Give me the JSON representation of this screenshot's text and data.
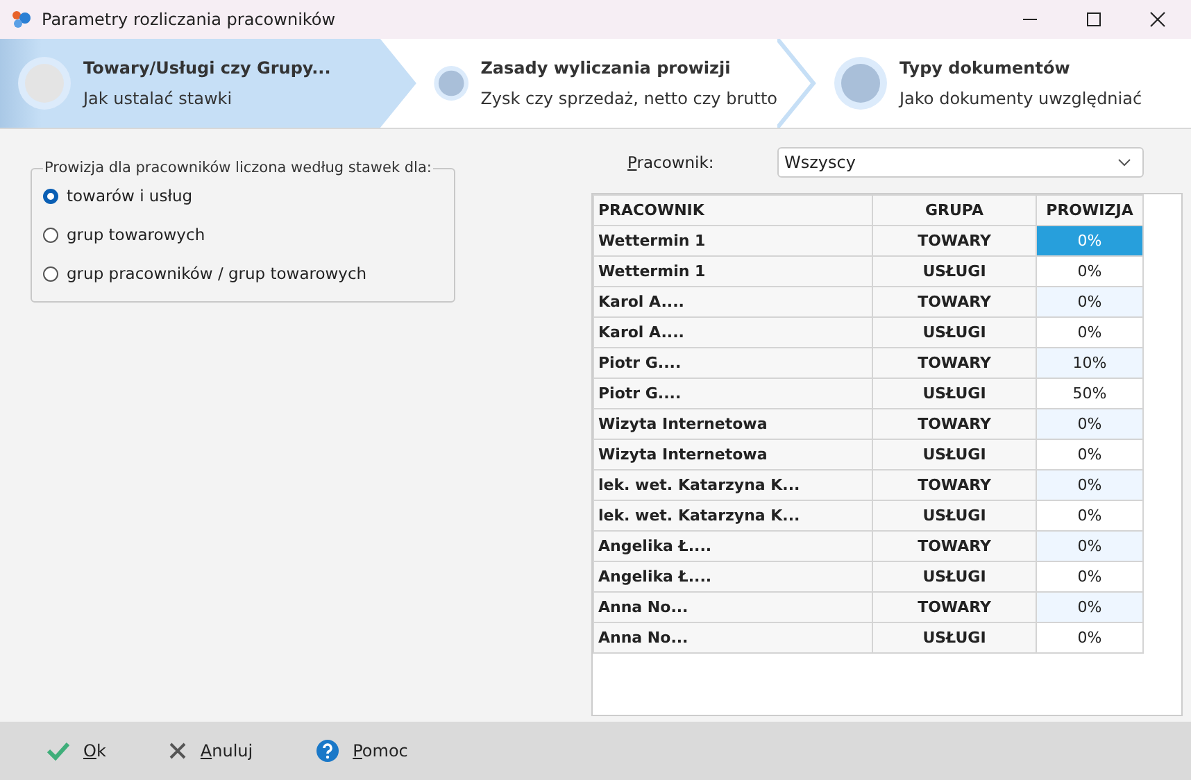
{
  "window": {
    "title": "Parametry rozliczania pracowników"
  },
  "steps": [
    {
      "title": "Towary/Usługi  czy  Grupy...",
      "subtitle": "Jak ustalać stawki",
      "selected": true
    },
    {
      "title": "Zasady wyliczania prowizji",
      "subtitle": "Zysk czy sprzedaż, netto czy brutto",
      "selected": false
    },
    {
      "title": "Typy dokumentów",
      "subtitle": "Jako dokumenty uwzględniać",
      "selected": false
    }
  ],
  "rate_group": {
    "legend": "Prowizja dla pracowników liczona według stawek dla:",
    "options": [
      {
        "label": "towarów i usług",
        "selected": true
      },
      {
        "label": "grup towarowych",
        "selected": false
      },
      {
        "label": "grup pracowników / grup towarowych",
        "selected": false
      }
    ]
  },
  "employee_filter": {
    "label": "Pracownik:",
    "value": "Wszyscy"
  },
  "table": {
    "columns": [
      "PRACOWNIK",
      "GRUPA",
      "PROWIZJA"
    ],
    "rows": [
      {
        "employee": "Wettermin 1",
        "group": "TOWARY",
        "commission": "0%",
        "selected": true
      },
      {
        "employee": "Wettermin 1",
        "group": "USŁUGI",
        "commission": "0%",
        "selected": false
      },
      {
        "employee": "Karol A....",
        "group": "TOWARY",
        "commission": "0%",
        "selected": false
      },
      {
        "employee": "Karol A....",
        "group": "USŁUGI",
        "commission": "0%",
        "selected": false
      },
      {
        "employee": "Piotr G....",
        "group": "TOWARY",
        "commission": "10%",
        "selected": false
      },
      {
        "employee": "Piotr G....",
        "group": "USŁUGI",
        "commission": "50%",
        "selected": false
      },
      {
        "employee": "Wizyta  Internetowa",
        "group": "TOWARY",
        "commission": "0%",
        "selected": false
      },
      {
        "employee": "Wizyta  Internetowa",
        "group": "USŁUGI",
        "commission": "0%",
        "selected": false
      },
      {
        "employee": "lek. wet. Katarzyna K...",
        "group": "TOWARY",
        "commission": "0%",
        "selected": false
      },
      {
        "employee": "lek. wet. Katarzyna K...",
        "group": "USŁUGI",
        "commission": "0%",
        "selected": false
      },
      {
        "employee": "Angelika Ł....",
        "group": "TOWARY",
        "commission": "0%",
        "selected": false
      },
      {
        "employee": "Angelika Ł....",
        "group": "USŁUGI",
        "commission": "0%",
        "selected": false
      },
      {
        "employee": "Anna No...",
        "group": "TOWARY",
        "commission": "0%",
        "selected": false
      },
      {
        "employee": "Anna No...",
        "group": "USŁUGI",
        "commission": "0%",
        "selected": false
      }
    ]
  },
  "buttons": [
    {
      "kind": "ok",
      "label": "Ok"
    },
    {
      "kind": "cancel",
      "label": "Anuluj"
    },
    {
      "kind": "help",
      "label": "Pomoc"
    }
  ]
}
